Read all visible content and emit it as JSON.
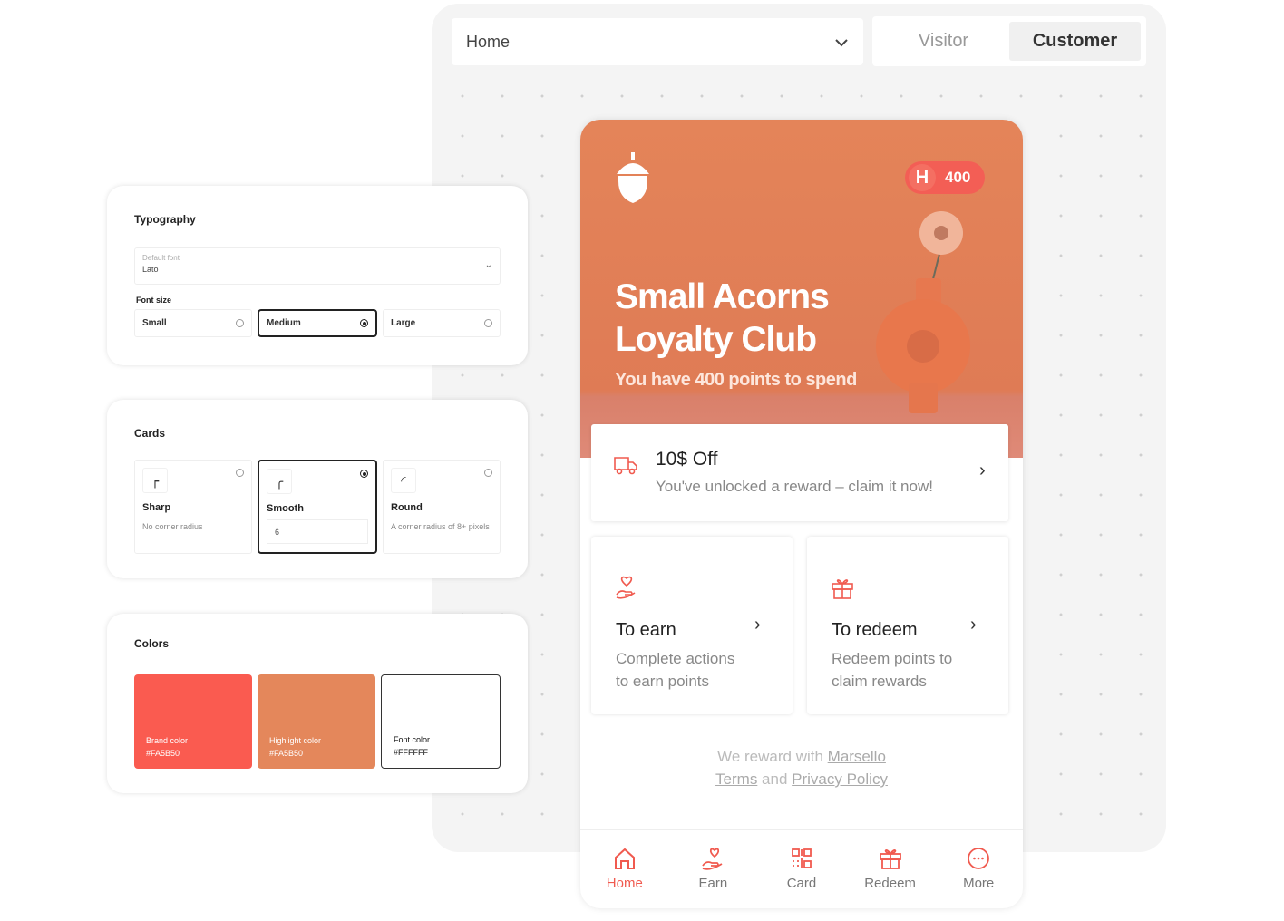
{
  "topbar": {
    "page_select": "Home",
    "view_toggle": [
      {
        "label": "Visitor",
        "active": false
      },
      {
        "label": "Customer",
        "active": true
      }
    ]
  },
  "typography": {
    "title": "Typography",
    "default_font_label": "Default font",
    "default_font_value": "Lato",
    "font_size_label": "Font size",
    "sizes": [
      {
        "label": "Small",
        "selected": false
      },
      {
        "label": "Medium",
        "selected": true
      },
      {
        "label": "Large",
        "selected": false
      }
    ]
  },
  "cards": {
    "title": "Cards",
    "options": [
      {
        "name": "Sharp",
        "desc": "No corner radius",
        "selected": false
      },
      {
        "name": "Smooth",
        "value": "6",
        "selected": true
      },
      {
        "name": "Round",
        "desc": "A corner radius of 8+ pixels",
        "selected": false
      }
    ]
  },
  "colors": {
    "title": "Colors",
    "swatches": [
      {
        "label": "Brand color",
        "hex": "#FA5B50",
        "swatch": "#fa5b50"
      },
      {
        "label": "Highlight color",
        "hex": "#FA5B50",
        "swatch": "#e4875b"
      },
      {
        "label": "Font color",
        "hex": "#FFFFFF",
        "swatch": "#ffffff"
      }
    ]
  },
  "phone": {
    "badge": {
      "letter": "H",
      "points": "400"
    },
    "title_line1": "Small Acorns",
    "title_line2": "Loyalty Club",
    "subtitle": "You have 400 points to spend",
    "reward": {
      "title": "10$ Off",
      "desc": "You've unlocked a reward – claim it now!"
    },
    "tiles": [
      {
        "title": "To earn",
        "desc1": "Complete actions",
        "desc2": "to earn points"
      },
      {
        "title": "To redeem",
        "desc1": "Redeem points to",
        "desc2": "claim rewards"
      }
    ],
    "footer": {
      "prefix": "We reward with ",
      "brand": "Marsello",
      "terms": "Terms",
      "and": " and ",
      "privacy": "Privacy Policy"
    },
    "nav": [
      {
        "label": "Home",
        "active": true
      },
      {
        "label": "Earn"
      },
      {
        "label": "Card"
      },
      {
        "label": "Redeem"
      },
      {
        "label": "More"
      }
    ],
    "accent": "#f05a4f"
  }
}
